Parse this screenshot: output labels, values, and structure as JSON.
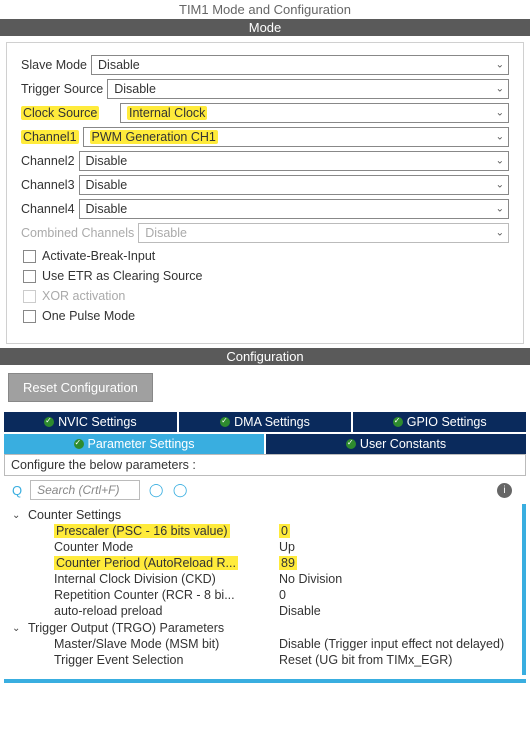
{
  "title": "TIM1 Mode and Configuration",
  "mode": {
    "header": "Mode",
    "slaveMode": {
      "label": "Slave Mode",
      "value": "Disable"
    },
    "triggerSource": {
      "label": "Trigger Source",
      "value": "Disable"
    },
    "clockSource": {
      "label": "Clock Source",
      "value": "Internal Clock"
    },
    "channel1": {
      "label": "Channel1",
      "value": "PWM Generation CH1"
    },
    "channel2": {
      "label": "Channel2",
      "value": "Disable"
    },
    "channel3": {
      "label": "Channel3",
      "value": "Disable"
    },
    "channel4": {
      "label": "Channel4",
      "value": "Disable"
    },
    "combined": {
      "label": "Combined Channels",
      "value": "Disable"
    },
    "checkboxes": {
      "activateBreak": "Activate-Break-Input",
      "useETR": "Use ETR as Clearing Source",
      "xor": "XOR activation",
      "onePulse": "One Pulse Mode"
    }
  },
  "config": {
    "header": "Configuration",
    "resetBtn": "Reset Configuration",
    "tabs": {
      "nvic": "NVIC Settings",
      "dma": "DMA Settings",
      "gpio": "GPIO Settings",
      "param": "Parameter Settings",
      "user": "User Constants"
    },
    "paramHead": "Configure the below parameters :",
    "searchPlaceholder": "Search (Crtl+F)",
    "groups": {
      "counter": {
        "title": "Counter Settings",
        "items": [
          {
            "name": "Prescaler (PSC - 16 bits value)",
            "value": "0"
          },
          {
            "name": "Counter Mode",
            "value": "Up"
          },
          {
            "name": "Counter Period (AutoReload R...",
            "value": "89"
          },
          {
            "name": "Internal Clock Division (CKD)",
            "value": "No Division"
          },
          {
            "name": "Repetition Counter (RCR - 8 bi...",
            "value": "0"
          },
          {
            "name": "auto-reload preload",
            "value": "Disable"
          }
        ]
      },
      "trgo": {
        "title": "Trigger Output (TRGO) Parameters",
        "items": [
          {
            "name": "Master/Slave Mode (MSM bit)",
            "value": "Disable (Trigger input effect not delayed)"
          },
          {
            "name": "Trigger Event Selection",
            "value": "Reset (UG bit from TIMx_EGR)"
          }
        ]
      }
    }
  }
}
